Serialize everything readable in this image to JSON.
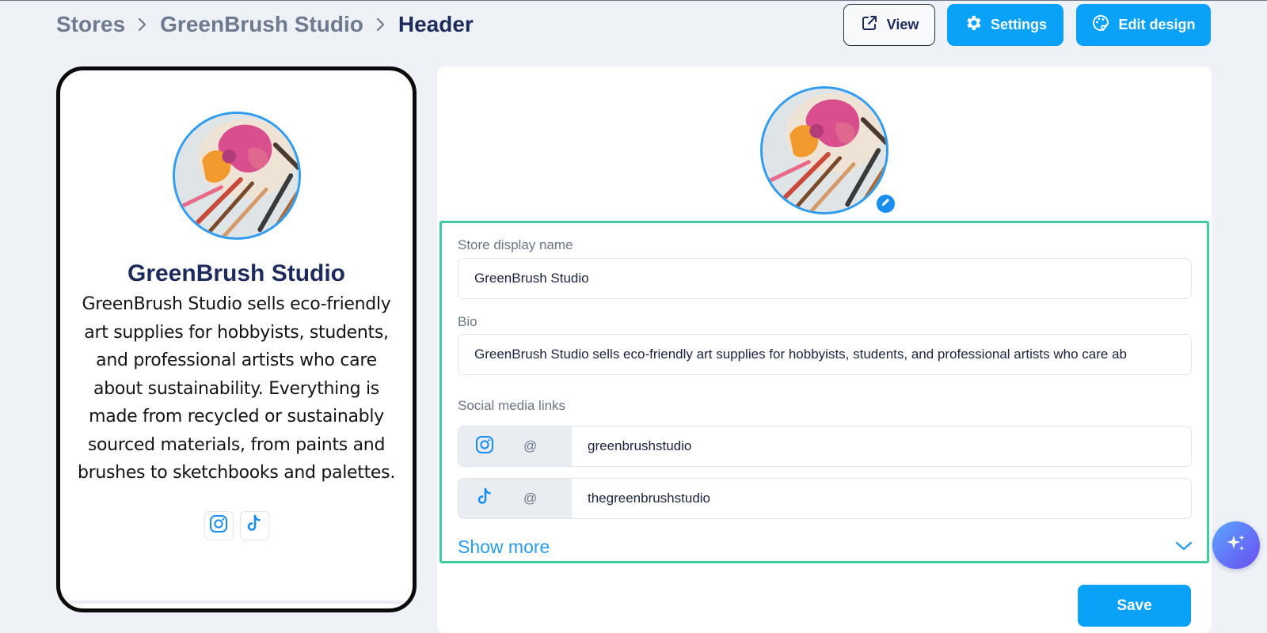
{
  "breadcrumb": {
    "items": [
      "Stores",
      "GreenBrush Studio",
      "Header"
    ]
  },
  "toolbar": {
    "view_label": "View",
    "settings_label": "Settings",
    "edit_design_label": "Edit design"
  },
  "preview": {
    "store_name": "GreenBrush Studio",
    "bio": "GreenBrush Studio sells eco-friendly art supplies for hobbyists, students, and professional artists who care about sustainability. Everything is made from recycled or sustainably sourced materials, from paints and brushes to sketchbooks and palettes.",
    "socials": [
      "instagram-icon",
      "tiktok-icon"
    ]
  },
  "form": {
    "store_name_label": "Store display name",
    "store_name_value": "GreenBrush Studio",
    "bio_label": "Bio",
    "bio_value": "GreenBrush Studio sells eco-friendly art supplies for hobbyists, students, and professional artists who care ab",
    "social_label": "Social media links",
    "socials": [
      {
        "icon": "instagram-icon",
        "prefix": "@",
        "handle": "greenbrushstudio"
      },
      {
        "icon": "tiktok-icon",
        "prefix": "@",
        "handle": "thegreenbrushstudio"
      }
    ],
    "show_more_label": "Show more",
    "save_label": "Save"
  },
  "colors": {
    "accent": "#0aa1f8",
    "highlight_border": "#3fcaa0",
    "title": "#1c2a5c",
    "background": "#eef2f6"
  }
}
